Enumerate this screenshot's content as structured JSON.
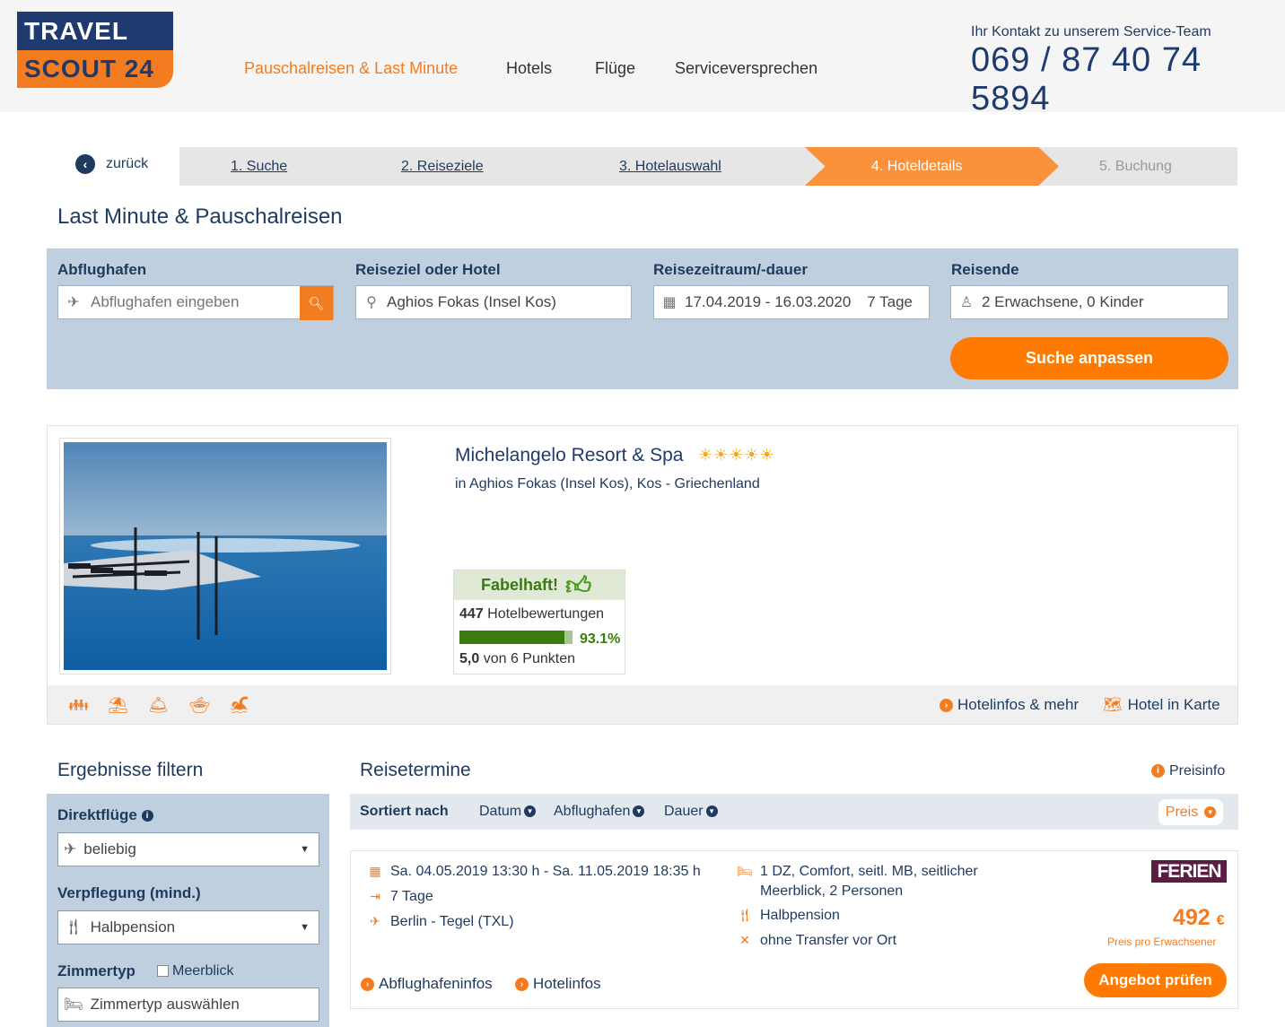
{
  "logo": {
    "line1": "TRAVEL",
    "line2": "SCOUT 24"
  },
  "nav": [
    {
      "label": "Pauschalreisen & Last Minute"
    },
    {
      "label": "Hotels"
    },
    {
      "label": "Flüge"
    },
    {
      "label": "Serviceversprechen"
    }
  ],
  "contact": {
    "label": "Ihr Kontakt zu unserem Service-Team",
    "phone": "069 / 87 40 74 5894"
  },
  "steps": {
    "back": "zurück",
    "items": [
      {
        "label": "1. Suche"
      },
      {
        "label": "2. Reiseziele"
      },
      {
        "label": "3. Hotelauswahl"
      },
      {
        "label": "4. Hoteldetails"
      },
      {
        "label": "5. Buchung"
      }
    ]
  },
  "page_title": "Last Minute & Pauschalreisen",
  "search": {
    "airport_label": "Abflughafen",
    "airport_placeholder": "Abflughafen eingeben",
    "destination_label": "Reiseziel oder Hotel",
    "destination_value": "Aghios Fokas (Insel Kos)",
    "period_label": "Reisezeitraum/-dauer",
    "period_value": "17.04.2019 - 16.03.2020",
    "duration_value": "7 Tage",
    "travelers_label": "Reisende",
    "travelers_value": "2 Erwachsene, 0 Kinder",
    "adjust_button": "Suche anpassen"
  },
  "hotel": {
    "name": "Michelangelo Resort & Spa",
    "stars": 5,
    "location": "in Aghios Fokas (Insel Kos), Kos - Griechenland",
    "rating_label": "Fabelhaft!",
    "review_count": "447",
    "review_label": "Hotelbewertungen",
    "recommend_pct": 93.1,
    "recommend_text": "93.1%",
    "score": "5,0",
    "score_label": "von 6 Punkten",
    "amenities": [
      "family-icon",
      "beach-icon",
      "service-bell-icon",
      "dining-icon",
      "swimming-icon"
    ],
    "info_link": "Hotelinfos & mehr",
    "map_link": "Hotel in Karte"
  },
  "filter": {
    "title": "Ergebnisse filtern",
    "direct_label": "Direktflüge",
    "direct_value": "beliebig",
    "board_label": "Verpflegung (mind.)",
    "board_value": "Halbpension",
    "room_label": "Zimmertyp",
    "seaview_label": "Meerblick",
    "room_placeholder": "Zimmertyp auswählen"
  },
  "results": {
    "title": "Reisetermine",
    "priceinfo": "Preisinfo",
    "sort_label": "Sortiert nach",
    "sort_options": [
      {
        "label": "Datum"
      },
      {
        "label": "Abflughafen"
      },
      {
        "label": "Dauer"
      }
    ],
    "sort_active": "Preis",
    "offer": {
      "dates": "Sa. 04.05.2019 13:30 h - Sa. 11.05.2019 18:35 h",
      "duration": "7 Tage",
      "route": "Berlin - Tegel (TXL)",
      "room_line1": "1 DZ, Comfort, seitl. MB, seitlicher",
      "room_line2": "Meerblick, 2 Personen",
      "board": "Halbpension",
      "transfer": "ohne Transfer vor Ort",
      "operator": "FERIEN",
      "price": "492",
      "currency": "€",
      "price_note": "Preis pro Erwachsener",
      "check_button": "Angebot prüfen",
      "airport_link": "Abflughafeninfos",
      "hotel_link": "Hotelinfos"
    }
  }
}
